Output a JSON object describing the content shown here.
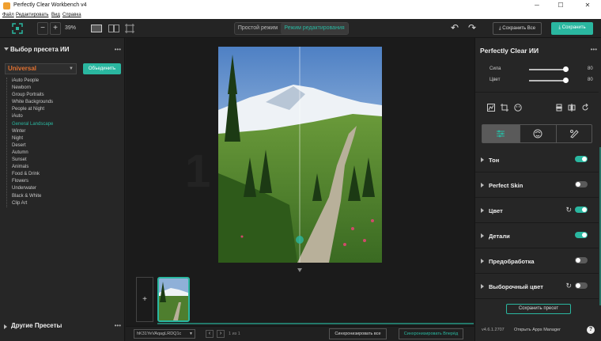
{
  "window": {
    "title": "Perfectly Clear Workbench v4",
    "minimize": "─",
    "maximize": "☐",
    "close": "✕"
  },
  "menu": [
    "Файл",
    "Редактировать",
    "Вид",
    "Справка"
  ],
  "toolbar": {
    "zoom_minus": "−",
    "zoom_plus": "+",
    "zoom_value": "39%",
    "mode_simple": "Простой режим",
    "mode_edit": "Режим редактирования",
    "undo": "↶",
    "redo": "↷",
    "save_all": "Сохранить Все",
    "save": "Сохранить"
  },
  "left": {
    "title": "Выбор пресета ИИ",
    "dots": "•••",
    "selected_preset": "Universal",
    "merge_button": "Объединить",
    "presets": [
      "iAuto People",
      "Newborn",
      "Group Portraits",
      "White Backgrounds",
      "People at Night",
      "iAuto",
      "General Landscape",
      "Winter",
      "Night",
      "Desert",
      "Autumn",
      "Sunset",
      "Animals",
      "Food & Drink",
      "Flowers",
      "Underwater",
      "Black & White",
      "Clip Art"
    ],
    "selected_index": 6,
    "other_presets": "Другие Пресеты"
  },
  "center": {
    "watermark": "1",
    "add_image": "+",
    "filmstrip_dropdown": "hK31YeVAqagLRDQ1c",
    "page_counter": "1 из 1",
    "sync_all": "Синхронизировать все",
    "sync_selected": "Синхронизировать Вперёд"
  },
  "right": {
    "title": "Perfectly Clear ИИ",
    "sliders": [
      {
        "label": "Сила",
        "value": 80
      },
      {
        "label": "Цвет",
        "value": 80
      }
    ],
    "sections": [
      {
        "label": "Тон",
        "on": true,
        "refresh": false
      },
      {
        "label": "Perfect Skin",
        "on": false,
        "refresh": false
      },
      {
        "label": "Цвет",
        "on": true,
        "refresh": true
      },
      {
        "label": "Детали",
        "on": true,
        "refresh": false
      },
      {
        "label": "Предобработка",
        "on": false,
        "refresh": false
      },
      {
        "label": "Выборочный цвет",
        "on": false,
        "refresh": true
      }
    ],
    "save_preset": "Сохранить пресет",
    "version": "v4.6.1.2707",
    "apps_manager": "Открыть Apps Manager",
    "help": "?"
  },
  "colors": {
    "accent": "#2ab7a0",
    "preset_orange": "#e07030",
    "panel": "#262626"
  }
}
